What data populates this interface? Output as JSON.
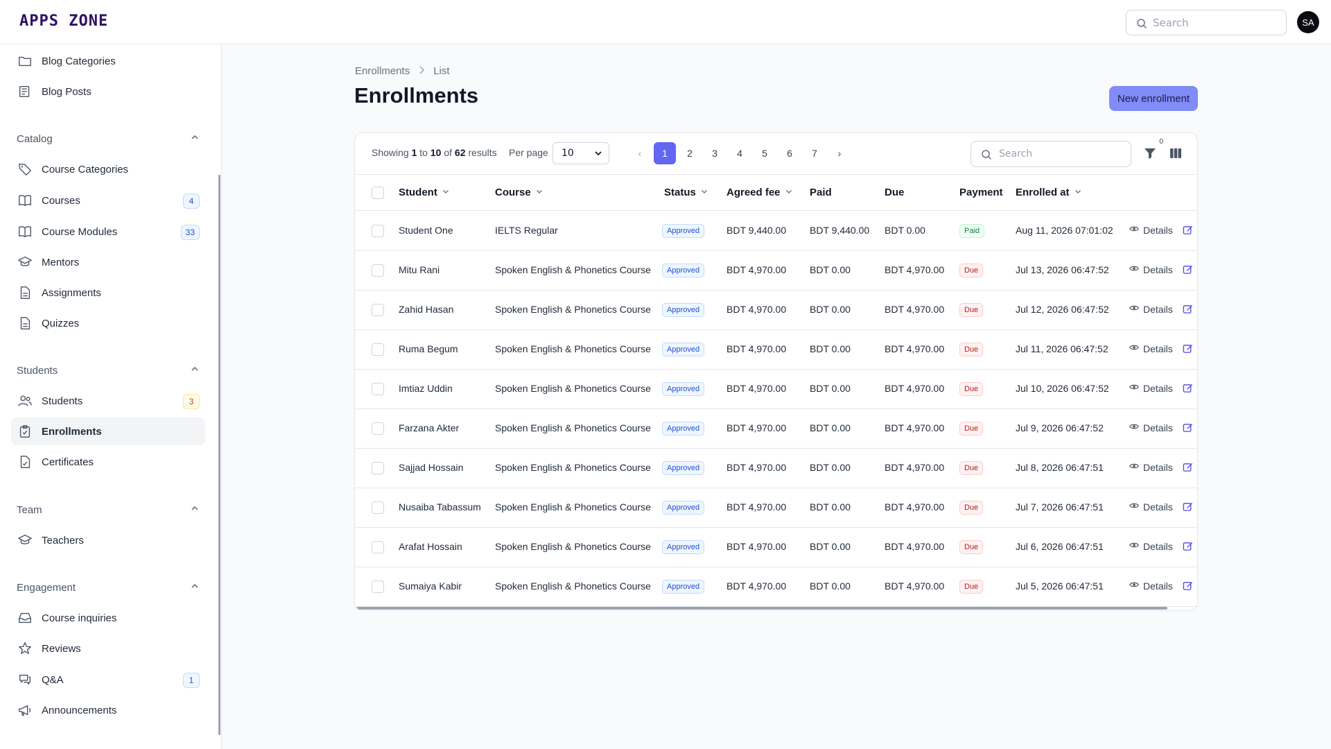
{
  "app": {
    "logo": "APPS ZONE",
    "avatar": "SA",
    "search_placeholder": "Search"
  },
  "sidebar": {
    "top_items": [
      {
        "label": "Blog Categories",
        "icon": "folder-icon"
      },
      {
        "label": "Blog Posts",
        "icon": "newspaper-icon"
      }
    ],
    "groups": [
      {
        "label": "Catalog",
        "items": [
          {
            "label": "Course Categories",
            "icon": "tag-icon",
            "badge": ""
          },
          {
            "label": "Courses",
            "icon": "book-icon",
            "badge": "4"
          },
          {
            "label": "Course Modules",
            "icon": "book-icon",
            "badge": "33"
          },
          {
            "label": "Mentors",
            "icon": "academic-cap-icon",
            "badge": ""
          },
          {
            "label": "Assignments",
            "icon": "document-icon",
            "badge": ""
          },
          {
            "label": "Quizzes",
            "icon": "document-icon",
            "badge": ""
          }
        ]
      },
      {
        "label": "Students",
        "items": [
          {
            "label": "Students",
            "icon": "users-icon",
            "badge": "3"
          },
          {
            "label": "Enrollments",
            "icon": "clipboard-check-icon",
            "badge": "",
            "active": true
          },
          {
            "label": "Certificates",
            "icon": "document-check-icon",
            "badge": ""
          }
        ]
      },
      {
        "label": "Team",
        "items": [
          {
            "label": "Teachers",
            "icon": "academic-cap-icon",
            "badge": ""
          }
        ]
      },
      {
        "label": "Engagement",
        "items": [
          {
            "label": "Course inquiries",
            "icon": "inbox-icon",
            "badge": ""
          },
          {
            "label": "Reviews",
            "icon": "star-icon",
            "badge": ""
          },
          {
            "label": "Q&A",
            "icon": "chat-icon",
            "badge": "1"
          },
          {
            "label": "Announcements",
            "icon": "megaphone-icon",
            "badge": ""
          }
        ]
      }
    ]
  },
  "breadcrumb": {
    "first": "Enrollments",
    "second": "List"
  },
  "page": {
    "title": "Enrollments",
    "new_button": "New enrollment"
  },
  "toolbar": {
    "showing_prefix": "Showing",
    "from": "1",
    "to_word": "to",
    "to": "10",
    "of_word": "of",
    "total": "62",
    "results_word": "results",
    "per_page_label": "Per page",
    "per_page_value": "10",
    "pages": [
      "1",
      "2",
      "3",
      "4",
      "5",
      "6",
      "7"
    ],
    "current_page": "1",
    "prev": "‹",
    "next": "›",
    "search_placeholder": "Search",
    "filter_count": "0"
  },
  "table": {
    "columns": [
      "Student",
      "Course",
      "Status",
      "Agreed fee",
      "Paid",
      "Due",
      "Payment",
      "Enrolled at"
    ],
    "details_label": "Details",
    "rows": [
      {
        "student": "Student One",
        "course": "IELTS Regular",
        "status": "Approved",
        "agreed_fee": "BDT 9,440.00",
        "paid": "BDT 9,440.00",
        "due": "BDT 0.00",
        "payment": "Paid",
        "enrolled_at": "Aug 11, 2026 07:01:02"
      },
      {
        "student": "Mitu Rani",
        "course": "Spoken English & Phonetics Course",
        "status": "Approved",
        "agreed_fee": "BDT 4,970.00",
        "paid": "BDT 0.00",
        "due": "BDT 4,970.00",
        "payment": "Due",
        "enrolled_at": "Jul 13, 2026 06:47:52"
      },
      {
        "student": "Zahid Hasan",
        "course": "Spoken English & Phonetics Course",
        "status": "Approved",
        "agreed_fee": "BDT 4,970.00",
        "paid": "BDT 0.00",
        "due": "BDT 4,970.00",
        "payment": "Due",
        "enrolled_at": "Jul 12, 2026 06:47:52"
      },
      {
        "student": "Ruma Begum",
        "course": "Spoken English & Phonetics Course",
        "status": "Approved",
        "agreed_fee": "BDT 4,970.00",
        "paid": "BDT 0.00",
        "due": "BDT 4,970.00",
        "payment": "Due",
        "enrolled_at": "Jul 11, 2026 06:47:52"
      },
      {
        "student": "Imtiaz Uddin",
        "course": "Spoken English & Phonetics Course",
        "status": "Approved",
        "agreed_fee": "BDT 4,970.00",
        "paid": "BDT 0.00",
        "due": "BDT 4,970.00",
        "payment": "Due",
        "enrolled_at": "Jul 10, 2026 06:47:52"
      },
      {
        "student": "Farzana Akter",
        "course": "Spoken English & Phonetics Course",
        "status": "Approved",
        "agreed_fee": "BDT 4,970.00",
        "paid": "BDT 0.00",
        "due": "BDT 4,970.00",
        "payment": "Due",
        "enrolled_at": "Jul 9, 2026 06:47:52"
      },
      {
        "student": "Sajjad Hossain",
        "course": "Spoken English & Phonetics Course",
        "status": "Approved",
        "agreed_fee": "BDT 4,970.00",
        "paid": "BDT 0.00",
        "due": "BDT 4,970.00",
        "payment": "Due",
        "enrolled_at": "Jul 8, 2026 06:47:51"
      },
      {
        "student": "Nusaiba Tabassum",
        "course": "Spoken English & Phonetics Course",
        "status": "Approved",
        "agreed_fee": "BDT 4,970.00",
        "paid": "BDT 0.00",
        "due": "BDT 4,970.00",
        "payment": "Due",
        "enrolled_at": "Jul 7, 2026 06:47:51"
      },
      {
        "student": "Arafat Hossain",
        "course": "Spoken English & Phonetics Course",
        "status": "Approved",
        "agreed_fee": "BDT 4,970.00",
        "paid": "BDT 0.00",
        "due": "BDT 4,970.00",
        "payment": "Due",
        "enrolled_at": "Jul 6, 2026 06:47:51"
      },
      {
        "student": "Sumaiya Kabir",
        "course": "Spoken English & Phonetics Course",
        "status": "Approved",
        "agreed_fee": "BDT 4,970.00",
        "paid": "BDT 0.00",
        "due": "BDT 4,970.00",
        "payment": "Due",
        "enrolled_at": "Jul 5, 2026 06:47:51"
      }
    ]
  },
  "colors": {
    "accent": "#6366f1",
    "button": "#818cf8",
    "logo": "#2e1065"
  }
}
